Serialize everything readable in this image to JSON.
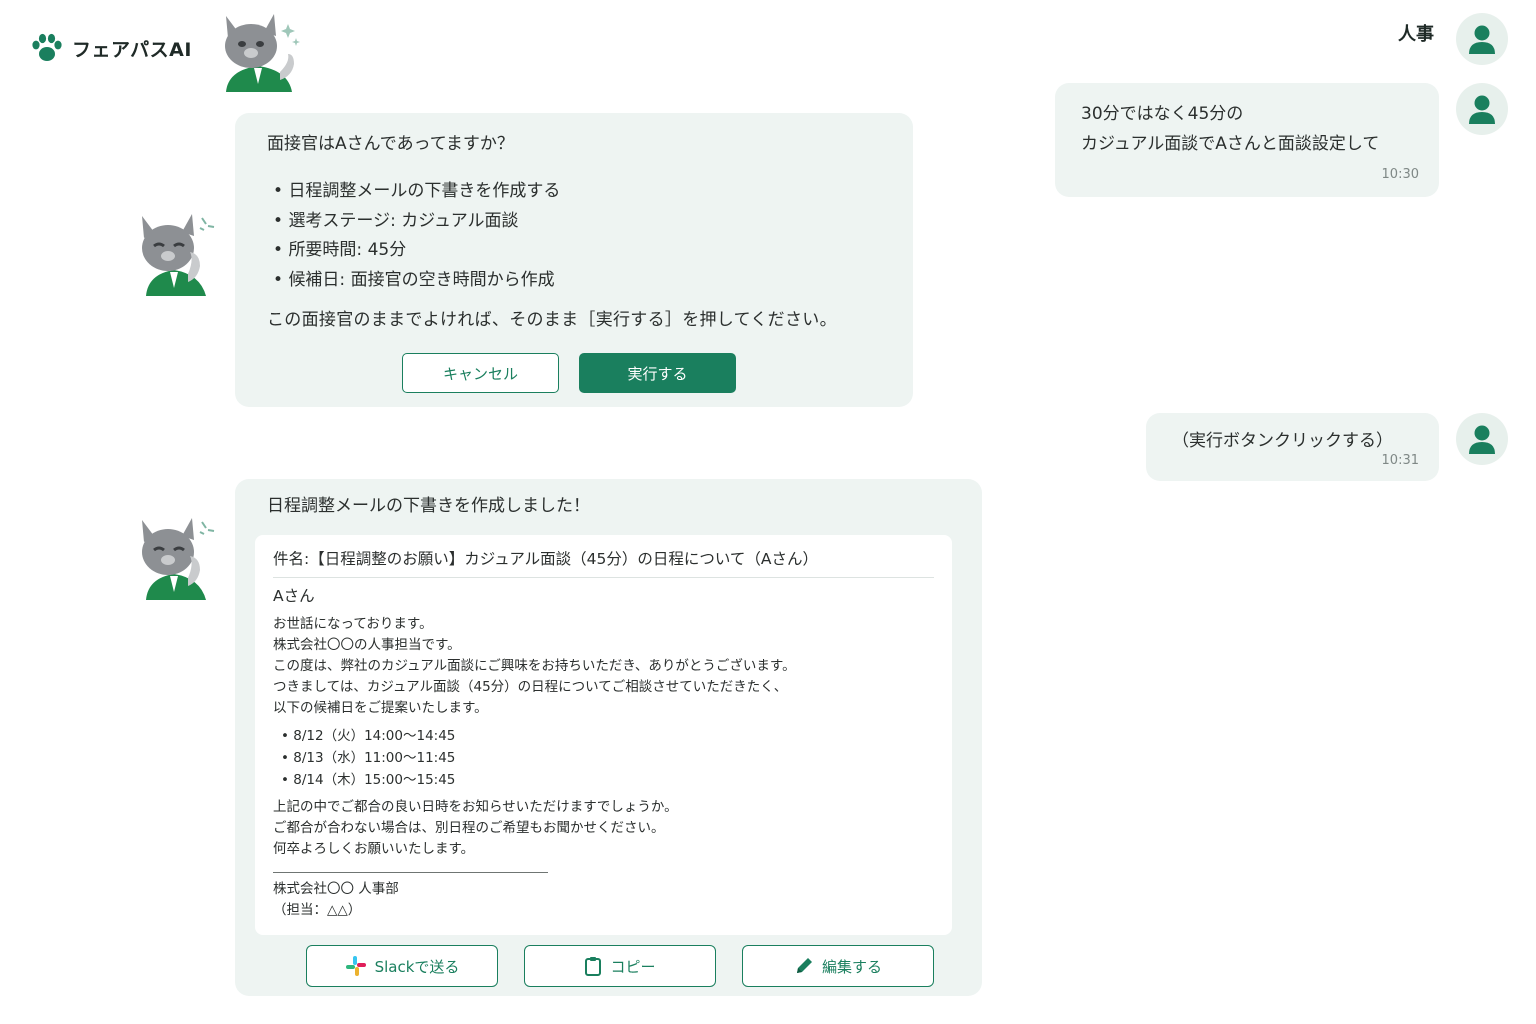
{
  "brand": {
    "name": "フェアパスAI",
    "logo_icon": "paw-icon"
  },
  "user": {
    "label": "人事",
    "avatar_icon": "user-icon"
  },
  "colors": {
    "primary": "#1a7f5e",
    "bubble": "#eef4f2",
    "avatar_bg": "#e7f0ec"
  },
  "messages": {
    "user_1": {
      "lines": [
        "30分ではなく45分の",
        "カジュアル面談でAさんと面談設定して"
      ],
      "time": "10:30"
    },
    "bot_1": {
      "question": "面接官はAさんであってますか？",
      "items": [
        "日程調整メールの下書きを作成する",
        "選考ステージ: カジュアル面談",
        "所要時間: 45分",
        "候補日: 面接官の空き時間から作成"
      ],
      "note": "この面接官のままでよければ、そのまま［実行する］を押してください。",
      "cancel_label": "キャンセル",
      "run_label": "実行する"
    },
    "user_2": {
      "line": "（実行ボタンクリックする）",
      "time": "10:31"
    },
    "bot_2": {
      "done": "日程調整メールの下書きを作成しました！",
      "email": {
        "subject": "件名:【日程調整のお願い】カジュアル面談（45分）の日程について（Aさん）",
        "to": "Aさん",
        "intro": [
          "お世話になっております。",
          "株式会社〇〇の人事担当です。",
          "この度は、弊社のカジュアル面談にご興味をお持ちいただき、ありがとうございます。",
          "つきましては、カジュアル面談（45分）の日程についてご相談させていただきたく、",
          "以下の候補日をご提案いたします。"
        ],
        "dates": [
          "8/12（火）14:00〜14:45",
          "8/13（水）11:00〜11:45",
          "8/14（木）15:00〜15:45"
        ],
        "closing": [
          "上記の中でご都合の良い日時をお知らせいただけますでしょうか。",
          "ご都合が合わない場合は、別日程のご希望もお聞かせください。",
          "何卒よろしくお願いいたします。"
        ],
        "signature": [
          "株式会社〇〇 人事部",
          "（担当：△△）"
        ]
      },
      "actions": {
        "slack_label": "Slackで送る",
        "copy_label": "コピー",
        "edit_label": "編集する"
      }
    }
  }
}
